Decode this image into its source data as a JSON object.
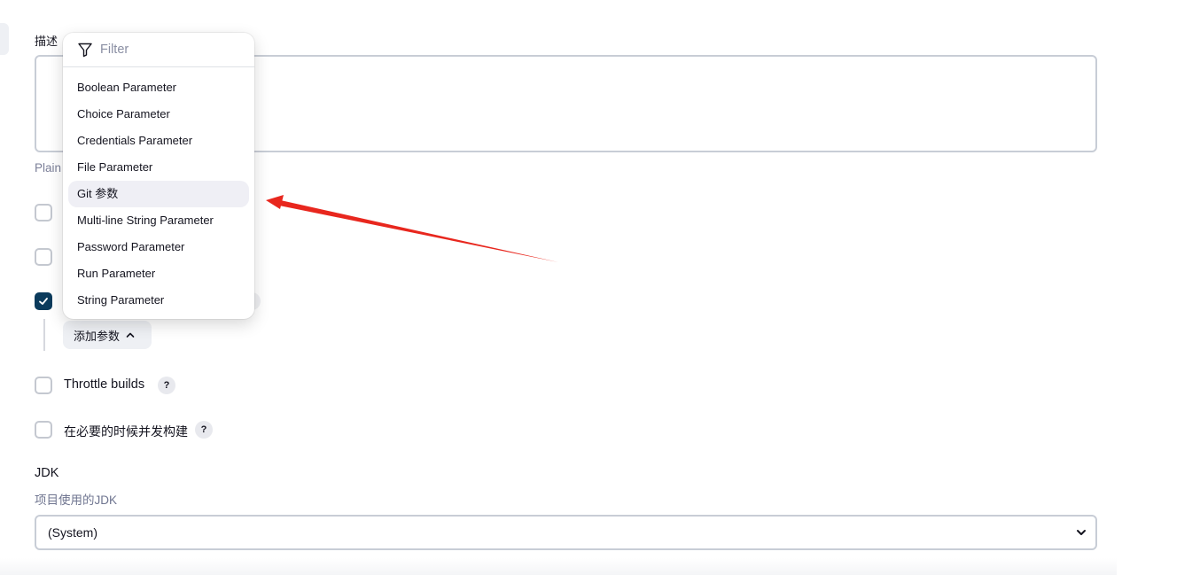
{
  "description": {
    "label": "描述",
    "value": "",
    "plain_text_link": "Plain"
  },
  "parameter_menu": {
    "filter_placeholder": "Filter",
    "items": [
      {
        "label": "Boolean Parameter"
      },
      {
        "label": "Choice Parameter"
      },
      {
        "label": "Credentials Parameter"
      },
      {
        "label": "File Parameter"
      },
      {
        "label": "Git 参数"
      },
      {
        "label": "Multi-line String Parameter"
      },
      {
        "label": "Password Parameter"
      },
      {
        "label": "Run Parameter"
      },
      {
        "label": "String Parameter"
      }
    ],
    "highlighted_item": "Git 参数"
  },
  "add_parameter_button": {
    "label": "添加参数",
    "icon": "chevron-up-icon"
  },
  "options": [
    {
      "label": "",
      "checked": false
    },
    {
      "label": "",
      "checked": false
    },
    {
      "label": "",
      "checked": true
    },
    {
      "label": "Throttle builds",
      "checked": false,
      "help": "?"
    },
    {
      "label": "在必要的时候并发构建",
      "checked": false,
      "help": "?"
    }
  ],
  "jdk": {
    "title": "JDK",
    "subtitle": "项目使用的JDK",
    "selected": "(System)"
  },
  "colors": {
    "accent": "#0b3b5c",
    "annotation_arrow": "#e8271e",
    "menu_highlight": "#efeff5"
  }
}
